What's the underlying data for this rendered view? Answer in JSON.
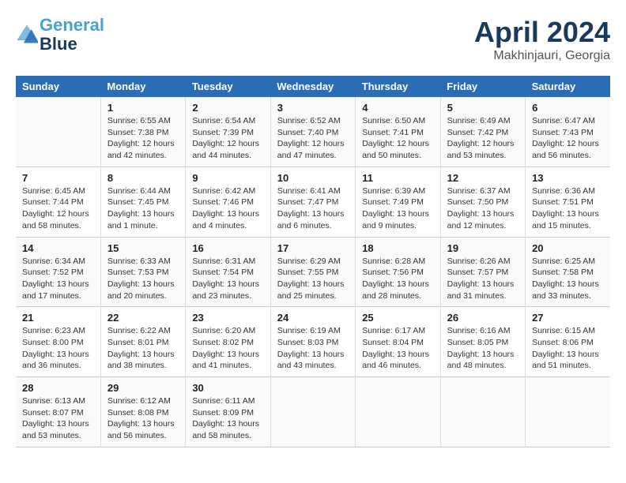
{
  "header": {
    "logo_line1": "General",
    "logo_line2": "Blue",
    "month": "April 2024",
    "location": "Makhinjauri, Georgia"
  },
  "days_of_week": [
    "Sunday",
    "Monday",
    "Tuesday",
    "Wednesday",
    "Thursday",
    "Friday",
    "Saturday"
  ],
  "weeks": [
    [
      {
        "day": "",
        "sunrise": "",
        "sunset": "",
        "daylight": ""
      },
      {
        "day": "1",
        "sunrise": "Sunrise: 6:55 AM",
        "sunset": "Sunset: 7:38 PM",
        "daylight": "Daylight: 12 hours and 42 minutes."
      },
      {
        "day": "2",
        "sunrise": "Sunrise: 6:54 AM",
        "sunset": "Sunset: 7:39 PM",
        "daylight": "Daylight: 12 hours and 44 minutes."
      },
      {
        "day": "3",
        "sunrise": "Sunrise: 6:52 AM",
        "sunset": "Sunset: 7:40 PM",
        "daylight": "Daylight: 12 hours and 47 minutes."
      },
      {
        "day": "4",
        "sunrise": "Sunrise: 6:50 AM",
        "sunset": "Sunset: 7:41 PM",
        "daylight": "Daylight: 12 hours and 50 minutes."
      },
      {
        "day": "5",
        "sunrise": "Sunrise: 6:49 AM",
        "sunset": "Sunset: 7:42 PM",
        "daylight": "Daylight: 12 hours and 53 minutes."
      },
      {
        "day": "6",
        "sunrise": "Sunrise: 6:47 AM",
        "sunset": "Sunset: 7:43 PM",
        "daylight": "Daylight: 12 hours and 56 minutes."
      }
    ],
    [
      {
        "day": "7",
        "sunrise": "Sunrise: 6:45 AM",
        "sunset": "Sunset: 7:44 PM",
        "daylight": "Daylight: 12 hours and 58 minutes."
      },
      {
        "day": "8",
        "sunrise": "Sunrise: 6:44 AM",
        "sunset": "Sunset: 7:45 PM",
        "daylight": "Daylight: 13 hours and 1 minute."
      },
      {
        "day": "9",
        "sunrise": "Sunrise: 6:42 AM",
        "sunset": "Sunset: 7:46 PM",
        "daylight": "Daylight: 13 hours and 4 minutes."
      },
      {
        "day": "10",
        "sunrise": "Sunrise: 6:41 AM",
        "sunset": "Sunset: 7:47 PM",
        "daylight": "Daylight: 13 hours and 6 minutes."
      },
      {
        "day": "11",
        "sunrise": "Sunrise: 6:39 AM",
        "sunset": "Sunset: 7:49 PM",
        "daylight": "Daylight: 13 hours and 9 minutes."
      },
      {
        "day": "12",
        "sunrise": "Sunrise: 6:37 AM",
        "sunset": "Sunset: 7:50 PM",
        "daylight": "Daylight: 13 hours and 12 minutes."
      },
      {
        "day": "13",
        "sunrise": "Sunrise: 6:36 AM",
        "sunset": "Sunset: 7:51 PM",
        "daylight": "Daylight: 13 hours and 15 minutes."
      }
    ],
    [
      {
        "day": "14",
        "sunrise": "Sunrise: 6:34 AM",
        "sunset": "Sunset: 7:52 PM",
        "daylight": "Daylight: 13 hours and 17 minutes."
      },
      {
        "day": "15",
        "sunrise": "Sunrise: 6:33 AM",
        "sunset": "Sunset: 7:53 PM",
        "daylight": "Daylight: 13 hours and 20 minutes."
      },
      {
        "day": "16",
        "sunrise": "Sunrise: 6:31 AM",
        "sunset": "Sunset: 7:54 PM",
        "daylight": "Daylight: 13 hours and 23 minutes."
      },
      {
        "day": "17",
        "sunrise": "Sunrise: 6:29 AM",
        "sunset": "Sunset: 7:55 PM",
        "daylight": "Daylight: 13 hours and 25 minutes."
      },
      {
        "day": "18",
        "sunrise": "Sunrise: 6:28 AM",
        "sunset": "Sunset: 7:56 PM",
        "daylight": "Daylight: 13 hours and 28 minutes."
      },
      {
        "day": "19",
        "sunrise": "Sunrise: 6:26 AM",
        "sunset": "Sunset: 7:57 PM",
        "daylight": "Daylight: 13 hours and 31 minutes."
      },
      {
        "day": "20",
        "sunrise": "Sunrise: 6:25 AM",
        "sunset": "Sunset: 7:58 PM",
        "daylight": "Daylight: 13 hours and 33 minutes."
      }
    ],
    [
      {
        "day": "21",
        "sunrise": "Sunrise: 6:23 AM",
        "sunset": "Sunset: 8:00 PM",
        "daylight": "Daylight: 13 hours and 36 minutes."
      },
      {
        "day": "22",
        "sunrise": "Sunrise: 6:22 AM",
        "sunset": "Sunset: 8:01 PM",
        "daylight": "Daylight: 13 hours and 38 minutes."
      },
      {
        "day": "23",
        "sunrise": "Sunrise: 6:20 AM",
        "sunset": "Sunset: 8:02 PM",
        "daylight": "Daylight: 13 hours and 41 minutes."
      },
      {
        "day": "24",
        "sunrise": "Sunrise: 6:19 AM",
        "sunset": "Sunset: 8:03 PM",
        "daylight": "Daylight: 13 hours and 43 minutes."
      },
      {
        "day": "25",
        "sunrise": "Sunrise: 6:17 AM",
        "sunset": "Sunset: 8:04 PM",
        "daylight": "Daylight: 13 hours and 46 minutes."
      },
      {
        "day": "26",
        "sunrise": "Sunrise: 6:16 AM",
        "sunset": "Sunset: 8:05 PM",
        "daylight": "Daylight: 13 hours and 48 minutes."
      },
      {
        "day": "27",
        "sunrise": "Sunrise: 6:15 AM",
        "sunset": "Sunset: 8:06 PM",
        "daylight": "Daylight: 13 hours and 51 minutes."
      }
    ],
    [
      {
        "day": "28",
        "sunrise": "Sunrise: 6:13 AM",
        "sunset": "Sunset: 8:07 PM",
        "daylight": "Daylight: 13 hours and 53 minutes."
      },
      {
        "day": "29",
        "sunrise": "Sunrise: 6:12 AM",
        "sunset": "Sunset: 8:08 PM",
        "daylight": "Daylight: 13 hours and 56 minutes."
      },
      {
        "day": "30",
        "sunrise": "Sunrise: 6:11 AM",
        "sunset": "Sunset: 8:09 PM",
        "daylight": "Daylight: 13 hours and 58 minutes."
      },
      {
        "day": "",
        "sunrise": "",
        "sunset": "",
        "daylight": ""
      },
      {
        "day": "",
        "sunrise": "",
        "sunset": "",
        "daylight": ""
      },
      {
        "day": "",
        "sunrise": "",
        "sunset": "",
        "daylight": ""
      },
      {
        "day": "",
        "sunrise": "",
        "sunset": "",
        "daylight": ""
      }
    ]
  ]
}
